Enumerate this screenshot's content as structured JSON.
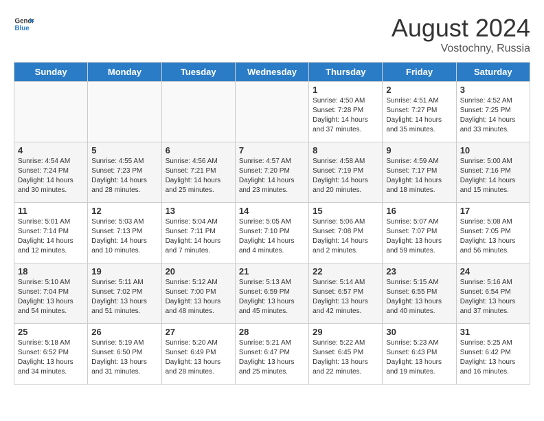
{
  "header": {
    "logo_general": "General",
    "logo_blue": "Blue",
    "month_year": "August 2024",
    "location": "Vostochny, Russia"
  },
  "weekdays": [
    "Sunday",
    "Monday",
    "Tuesday",
    "Wednesday",
    "Thursday",
    "Friday",
    "Saturday"
  ],
  "weeks": [
    [
      {
        "day": "",
        "empty": true
      },
      {
        "day": "",
        "empty": true
      },
      {
        "day": "",
        "empty": true
      },
      {
        "day": "",
        "empty": true
      },
      {
        "day": "1",
        "sunrise": "4:50 AM",
        "sunset": "7:28 PM",
        "daylight": "14 hours and 37 minutes."
      },
      {
        "day": "2",
        "sunrise": "4:51 AM",
        "sunset": "7:27 PM",
        "daylight": "14 hours and 35 minutes."
      },
      {
        "day": "3",
        "sunrise": "4:52 AM",
        "sunset": "7:25 PM",
        "daylight": "14 hours and 33 minutes."
      }
    ],
    [
      {
        "day": "4",
        "sunrise": "4:54 AM",
        "sunset": "7:24 PM",
        "daylight": "14 hours and 30 minutes."
      },
      {
        "day": "5",
        "sunrise": "4:55 AM",
        "sunset": "7:23 PM",
        "daylight": "14 hours and 28 minutes."
      },
      {
        "day": "6",
        "sunrise": "4:56 AM",
        "sunset": "7:21 PM",
        "daylight": "14 hours and 25 minutes."
      },
      {
        "day": "7",
        "sunrise": "4:57 AM",
        "sunset": "7:20 PM",
        "daylight": "14 hours and 23 minutes."
      },
      {
        "day": "8",
        "sunrise": "4:58 AM",
        "sunset": "7:19 PM",
        "daylight": "14 hours and 20 minutes."
      },
      {
        "day": "9",
        "sunrise": "4:59 AM",
        "sunset": "7:17 PM",
        "daylight": "14 hours and 18 minutes."
      },
      {
        "day": "10",
        "sunrise": "5:00 AM",
        "sunset": "7:16 PM",
        "daylight": "14 hours and 15 minutes."
      }
    ],
    [
      {
        "day": "11",
        "sunrise": "5:01 AM",
        "sunset": "7:14 PM",
        "daylight": "14 hours and 12 minutes."
      },
      {
        "day": "12",
        "sunrise": "5:03 AM",
        "sunset": "7:13 PM",
        "daylight": "14 hours and 10 minutes."
      },
      {
        "day": "13",
        "sunrise": "5:04 AM",
        "sunset": "7:11 PM",
        "daylight": "14 hours and 7 minutes."
      },
      {
        "day": "14",
        "sunrise": "5:05 AM",
        "sunset": "7:10 PM",
        "daylight": "14 hours and 4 minutes."
      },
      {
        "day": "15",
        "sunrise": "5:06 AM",
        "sunset": "7:08 PM",
        "daylight": "14 hours and 2 minutes."
      },
      {
        "day": "16",
        "sunrise": "5:07 AM",
        "sunset": "7:07 PM",
        "daylight": "13 hours and 59 minutes."
      },
      {
        "day": "17",
        "sunrise": "5:08 AM",
        "sunset": "7:05 PM",
        "daylight": "13 hours and 56 minutes."
      }
    ],
    [
      {
        "day": "18",
        "sunrise": "5:10 AM",
        "sunset": "7:04 PM",
        "daylight": "13 hours and 54 minutes."
      },
      {
        "day": "19",
        "sunrise": "5:11 AM",
        "sunset": "7:02 PM",
        "daylight": "13 hours and 51 minutes."
      },
      {
        "day": "20",
        "sunrise": "5:12 AM",
        "sunset": "7:00 PM",
        "daylight": "13 hours and 48 minutes."
      },
      {
        "day": "21",
        "sunrise": "5:13 AM",
        "sunset": "6:59 PM",
        "daylight": "13 hours and 45 minutes."
      },
      {
        "day": "22",
        "sunrise": "5:14 AM",
        "sunset": "6:57 PM",
        "daylight": "13 hours and 42 minutes."
      },
      {
        "day": "23",
        "sunrise": "5:15 AM",
        "sunset": "6:55 PM",
        "daylight": "13 hours and 40 minutes."
      },
      {
        "day": "24",
        "sunrise": "5:16 AM",
        "sunset": "6:54 PM",
        "daylight": "13 hours and 37 minutes."
      }
    ],
    [
      {
        "day": "25",
        "sunrise": "5:18 AM",
        "sunset": "6:52 PM",
        "daylight": "13 hours and 34 minutes."
      },
      {
        "day": "26",
        "sunrise": "5:19 AM",
        "sunset": "6:50 PM",
        "daylight": "13 hours and 31 minutes."
      },
      {
        "day": "27",
        "sunrise": "5:20 AM",
        "sunset": "6:49 PM",
        "daylight": "13 hours and 28 minutes."
      },
      {
        "day": "28",
        "sunrise": "5:21 AM",
        "sunset": "6:47 PM",
        "daylight": "13 hours and 25 minutes."
      },
      {
        "day": "29",
        "sunrise": "5:22 AM",
        "sunset": "6:45 PM",
        "daylight": "13 hours and 22 minutes."
      },
      {
        "day": "30",
        "sunrise": "5:23 AM",
        "sunset": "6:43 PM",
        "daylight": "13 hours and 19 minutes."
      },
      {
        "day": "31",
        "sunrise": "5:25 AM",
        "sunset": "6:42 PM",
        "daylight": "13 hours and 16 minutes."
      }
    ]
  ]
}
